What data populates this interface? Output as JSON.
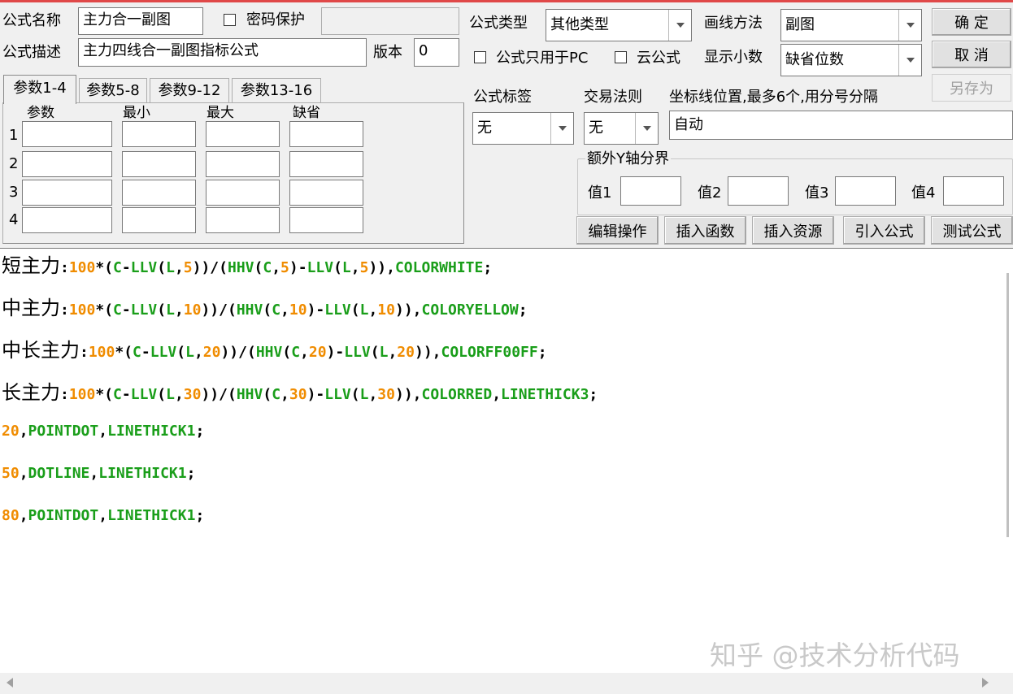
{
  "header": {
    "formula_name_label": "公式名称",
    "formula_name_value": "主力合一副图",
    "password_label": "密码保护",
    "formula_desc_label": "公式描述",
    "formula_desc_value": "主力四线合一副图指标公式",
    "version_label": "版本",
    "version_value": "0",
    "formula_type_label": "公式类型",
    "formula_type_value": "其他类型",
    "draw_method_label": "画线方法",
    "draw_method_value": "副图",
    "pc_only_label": "公式只用于PC",
    "cloud_label": "云公式",
    "decimals_label": "显示小数",
    "decimals_value": "缺省位数"
  },
  "buttons": {
    "ok": "确  定",
    "cancel": "取  消",
    "save_as": "另存为",
    "edit_ops": "编辑操作",
    "insert_func": "插入函数",
    "insert_res": "插入资源",
    "import_formula": "引入公式",
    "test_formula": "测试公式"
  },
  "params": {
    "tabs": [
      "参数1-4",
      "参数5-8",
      "参数9-12",
      "参数13-16"
    ],
    "columns": [
      "参数",
      "最小",
      "最大",
      "缺省"
    ],
    "rows": [
      "1",
      "2",
      "3",
      "4"
    ]
  },
  "settings": {
    "tag_label": "公式标签",
    "tag_value": "无",
    "trade_rule_label": "交易法则",
    "trade_rule_value": "无",
    "axis_label": "坐标线位置,最多6个,用分号分隔",
    "axis_value": "自动",
    "extra_y_label": "额外Y轴分界",
    "value_labels": [
      "值1",
      "值2",
      "值3",
      "值4"
    ]
  },
  "code": {
    "lines": [
      "短主力:100*(C-LLV(L,5))/(HHV(C,5)-LLV(L,5)),COLORWHITE;",
      "中主力:100*(C-LLV(L,10))/(HHV(C,10)-LLV(L,10)),COLORYELLOW;",
      "中长主力:100*(C-LLV(L,20))/(HHV(C,20)-LLV(L,20)),COLORFF00FF;",
      "长主力:100*(C-LLV(L,30))/(HHV(C,30)-LLV(L,30)),COLORRED,LINETHICK3;",
      "20,POINTDOT,LINETHICK1;",
      "50,DOTLINE,LINETHICK1;",
      "80,POINTDOT,LINETHICK1;"
    ]
  },
  "watermark": "知乎 @技术分析代码",
  "colors": {
    "number": "#f08c00",
    "keyword": "#1a9e1a",
    "accent_top": "#e04848"
  }
}
